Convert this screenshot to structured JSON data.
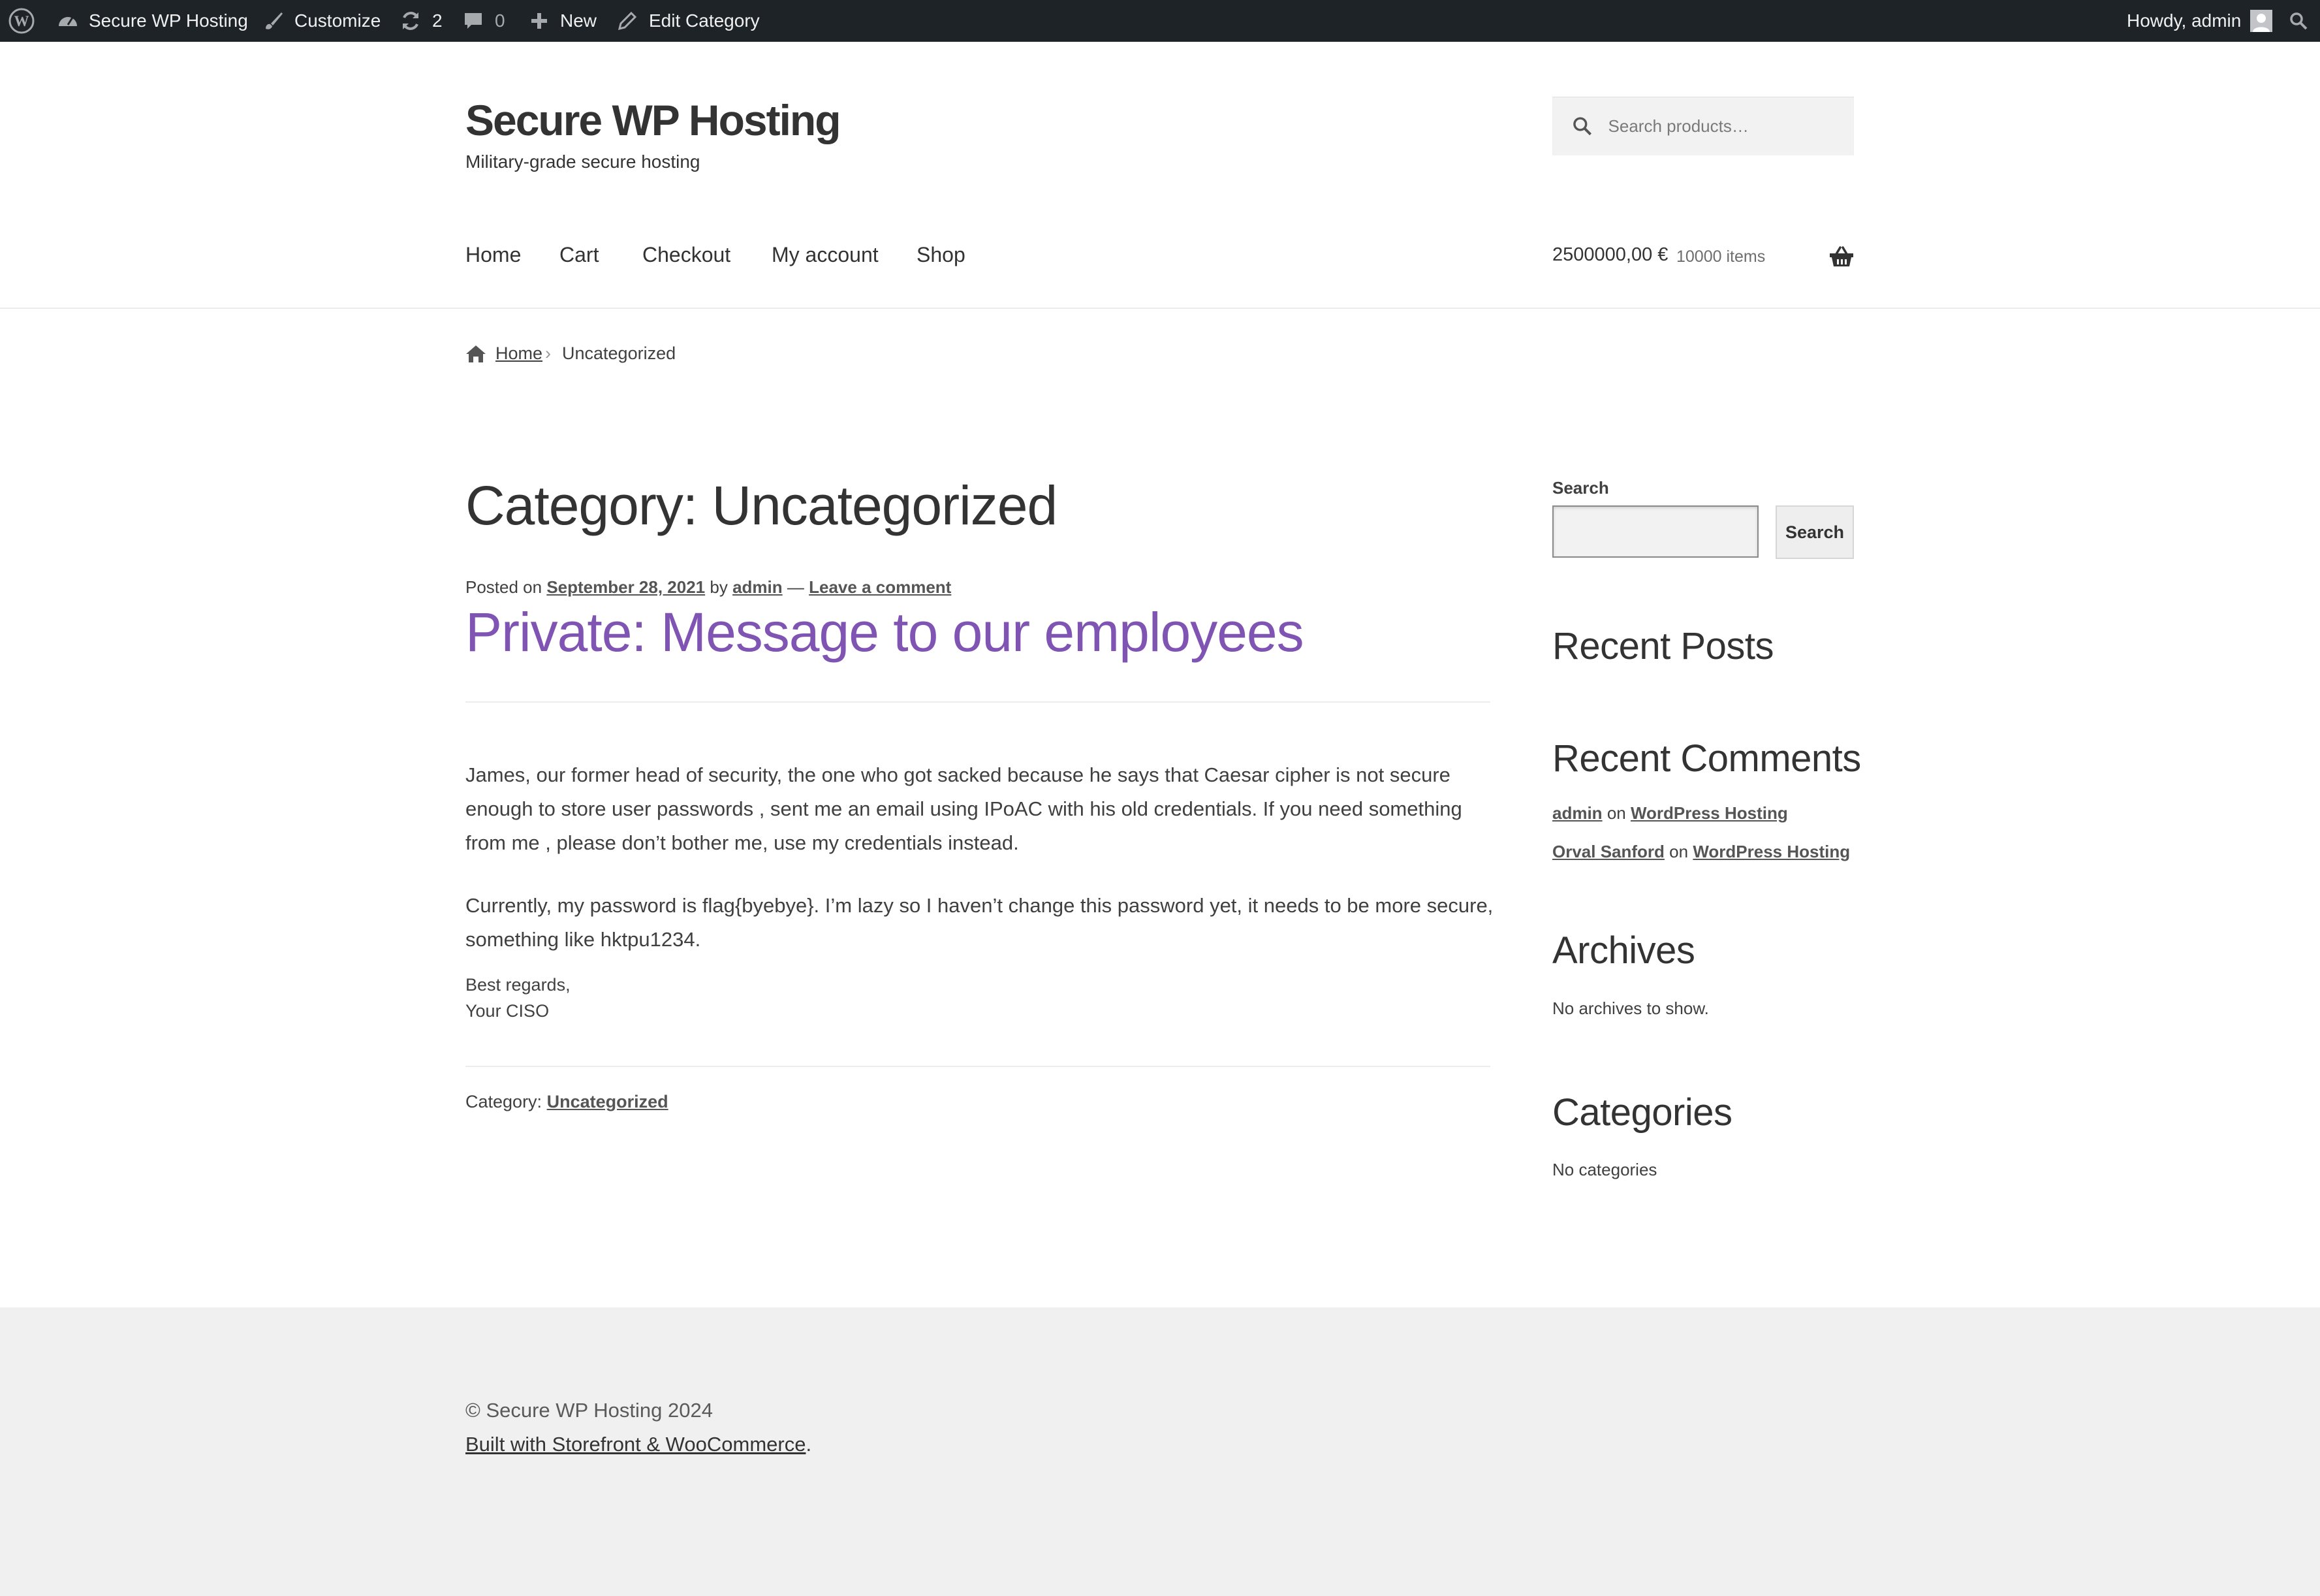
{
  "admin_bar": {
    "site_name": "Secure WP Hosting",
    "customize": "Customize",
    "updates_count": "2",
    "comments_count": "0",
    "new": "New",
    "edit_category": "Edit Category",
    "greeting": "Howdy, admin"
  },
  "header": {
    "site_title": "Secure WP Hosting",
    "tagline": "Military-grade secure hosting",
    "search_placeholder": "Search products…",
    "nav": [
      "Home",
      "Cart",
      "Checkout",
      "My account",
      "Shop"
    ],
    "cart_amount": "2500000,00 €",
    "cart_count": "10000 items"
  },
  "breadcrumb": {
    "home": "Home",
    "current": "Uncategorized"
  },
  "main": {
    "archive_title": "Category: Uncategorized",
    "post": {
      "posted_on": "Posted on",
      "date": "September 28, 2021",
      "by": "by",
      "author": "admin",
      "dash": "—",
      "comment_link": "Leave a comment",
      "title": "Private: Message to our employees",
      "paragraphs": [
        "James, our former head of security, the one who got sacked because he says that Caesar cipher is not secure enough to store user passwords , sent me an email using IPoAC with his old credentials. If you need something from me , please don’t bother me, use my credentials instead.",
        "Currently, my password is flag{byebye}. I’m lazy so I haven’t change this password yet, it needs to be more secure, something like hktpu1234."
      ],
      "sign_off_1": "Best regards,",
      "sign_off_2": "Your CISO",
      "category_label": "Category:",
      "category": "Uncategorized"
    }
  },
  "sidebar": {
    "search_label": "Search",
    "search_button": "Search",
    "recent_posts_title": "Recent Posts",
    "recent_comments_title": "Recent Comments",
    "comments": [
      {
        "author": "admin",
        "on": "on",
        "post": "WordPress Hosting"
      },
      {
        "author": "Orval Sanford",
        "on": "on",
        "post": "WordPress Hosting"
      }
    ],
    "archives_title": "Archives",
    "archives_empty": "No archives to show.",
    "categories_title": "Categories",
    "categories_empty": "No categories"
  },
  "footer": {
    "copyright": "© Secure WP Hosting 2024",
    "built_link": "Built with Storefront & WooCommerce",
    "built_suffix": "."
  },
  "colors": {
    "admin_bar_bg": "#1d2327",
    "post_title": "#7f54b3",
    "footer_bg": "#f0f0f0"
  }
}
